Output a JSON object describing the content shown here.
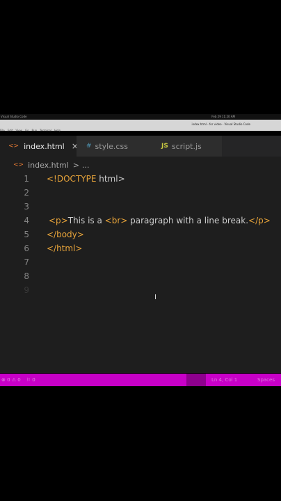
{
  "os_bar": {
    "app_name": "Visual Studio Code",
    "clock": "Feb 29 11:20 AM"
  },
  "menu_bar": {
    "window_title": "index.html - for video - Visual Studio Code",
    "menus": [
      "File",
      "Edit",
      "View",
      "Go",
      "Run",
      "Terminal",
      "Help"
    ]
  },
  "tabs": [
    {
      "label": "index.html",
      "icon": "<>",
      "active": true,
      "close": "×"
    },
    {
      "label": "style.css",
      "icon": "#",
      "active": false
    },
    {
      "label": "script.js",
      "icon": "JS",
      "active": false
    }
  ],
  "breadcrumb": {
    "icon": "<>",
    "file": "index.html",
    "separator": ">",
    "more": "..."
  },
  "editor_lines": {
    "numbers": [
      "1",
      "2",
      "3",
      "4",
      "5",
      "6",
      "7",
      "8",
      "9"
    ],
    "line1": {
      "open": "<!",
      "keyword": "DOCTYPE",
      "rest": " html>"
    },
    "line4": {
      "p_open": "<p>",
      "text1": "This is a ",
      "br": "<br>",
      "text2": " paragraph with a line break.",
      "p_close": "</p>"
    },
    "line5": "</body>",
    "line6": "</html>"
  },
  "status_bar": {
    "problems": "⊗ 0 ⚠ 0",
    "ports": "⚐ 0",
    "position": "Ln 4, Col 1",
    "spaces": "Spaces"
  },
  "colors": {
    "editor_bg": "#1e1e1e",
    "tag": "#e8a43a",
    "status_bg": "#c800c8"
  }
}
